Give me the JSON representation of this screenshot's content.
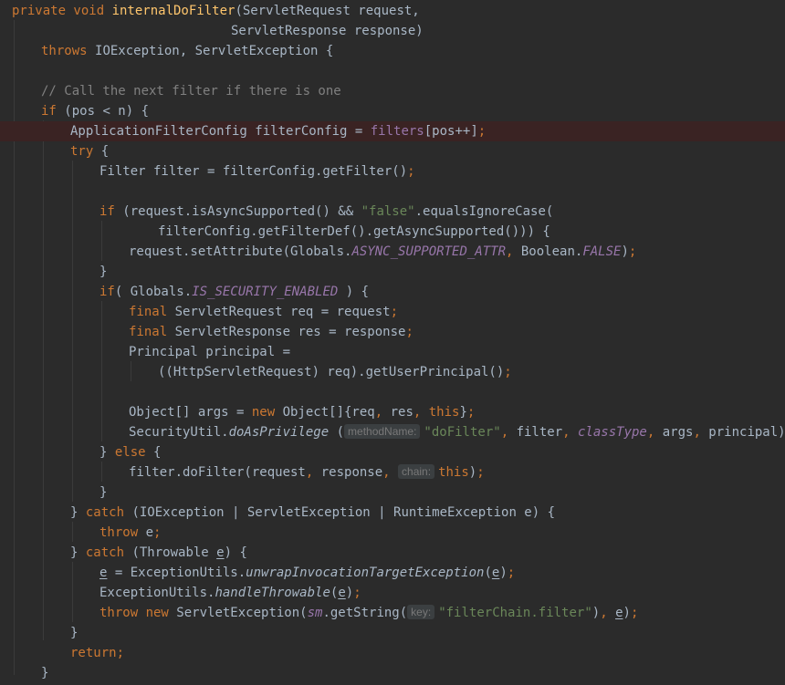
{
  "code": {
    "l1": {
      "t0": "private void ",
      "t1": "internalDoFilter",
      "t2": "(ServletRequest request,"
    },
    "l2": {
      "t0": "ServletResponse response)"
    },
    "l3": {
      "t0": "throws ",
      "t1": "IOException, ServletException {"
    },
    "l5": {
      "t0": "// Call the next filter if there is one"
    },
    "l6": {
      "t0": "if ",
      "t1": "(pos < n) {"
    },
    "l7": {
      "t0": "ApplicationFilterConfig filterConfig = ",
      "t1": "filters",
      "t2": "[pos++]",
      "t3": ";"
    },
    "l8": {
      "t0": "try ",
      "t1": "{"
    },
    "l9": {
      "t0": "Filter filter = filterConfig.getFilter()",
      "t1": ";"
    },
    "l11": {
      "t0": "if ",
      "t1": "(request.isAsyncSupported() && ",
      "t2": "\"false\"",
      "t3": ".equalsIgnoreCase("
    },
    "l12": {
      "t0": "filterConfig.getFilterDef().getAsyncSupported())) {"
    },
    "l13": {
      "t0": "request.setAttribute(Globals.",
      "t1": "ASYNC_SUPPORTED_ATTR",
      "t2": ", ",
      "t3": "Boolean.",
      "t4": "FALSE",
      "t5": ")",
      "t6": ";"
    },
    "l14": {
      "t0": "}"
    },
    "l15": {
      "t0": "if",
      "t1": "( Globals.",
      "t2": "IS_SECURITY_ENABLED",
      "t3": " ) {"
    },
    "l16": {
      "t0": "final ",
      "t1": "ServletRequest req = request",
      "t2": ";"
    },
    "l17": {
      "t0": "final ",
      "t1": "ServletResponse res = response",
      "t2": ";"
    },
    "l18": {
      "t0": "Principal principal ="
    },
    "l19": {
      "t0": "((HttpServletRequest) req).getUserPrincipal()",
      "t1": ";"
    },
    "l21": {
      "t0": "Object[] args = ",
      "t1": "new ",
      "t2": "Object[]{req",
      "t3": ", ",
      "t4": "res",
      "t5": ", ",
      "t6": "this",
      "t7": "}",
      "t8": ";"
    },
    "l22": {
      "t0": "SecurityUtil.",
      "t1": "doAsPrivilege ",
      "t2": "(",
      "hint": "methodName:",
      "t3": "\"doFilter\"",
      "t4": ", ",
      "t5": "filter",
      "t6": ", ",
      "t7": "classType",
      "t8": ", ",
      "t9": "args",
      "t10": ", ",
      "t11": "principal)",
      "t12": ";"
    },
    "l23": {
      "t0": "} ",
      "t1": "else ",
      "t2": "{"
    },
    "l24": {
      "t0": "filter.doFilter(request",
      "t1": ", ",
      "t2": "response",
      "t3": ", ",
      "hint": "chain:",
      "t4": "this",
      "t5": ")",
      "t6": ";"
    },
    "l25": {
      "t0": "}"
    },
    "l26": {
      "t0": "} ",
      "t1": "catch ",
      "t2": "(IOException | ServletException | RuntimeException e) {"
    },
    "l27": {
      "t0": "throw ",
      "t1": "e",
      "t2": ";"
    },
    "l28": {
      "t0": "} ",
      "t1": "catch ",
      "t2": "(Throwable ",
      "t3": "e",
      "t4": ") {"
    },
    "l29": {
      "t0": "e",
      "t1": " = ExceptionUtils.",
      "t2": "unwrapInvocationTargetException",
      "t3": "(",
      "t4": "e",
      "t5": ")",
      "t6": ";"
    },
    "l30": {
      "t0": "ExceptionUtils.",
      "t1": "handleThrowable",
      "t2": "(",
      "t3": "e",
      "t4": ")",
      "t5": ";"
    },
    "l31": {
      "t0": "throw new ",
      "t1": "ServletException(",
      "t2": "sm",
      "t3": ".getString(",
      "hint": "key:",
      "t4": "\"filterChain.filter\"",
      "t5": ")",
      "t6": ", ",
      "t7": "e",
      "t8": ")",
      "t9": ";"
    },
    "l32": {
      "t0": "}"
    },
    "l33": {
      "t0": "return",
      "t1": ";"
    },
    "l34": {
      "t0": "}"
    }
  },
  "colors": {
    "background": "#2b2b2b",
    "keyword": "#cc7832",
    "method_declaration": "#ffc66d",
    "string": "#6a8759",
    "comment": "#808080",
    "field": "#9876aa",
    "default_text": "#a9b7c6",
    "highlight_line": "#3a2323",
    "inlay_hint_bg": "#3b3f41"
  }
}
